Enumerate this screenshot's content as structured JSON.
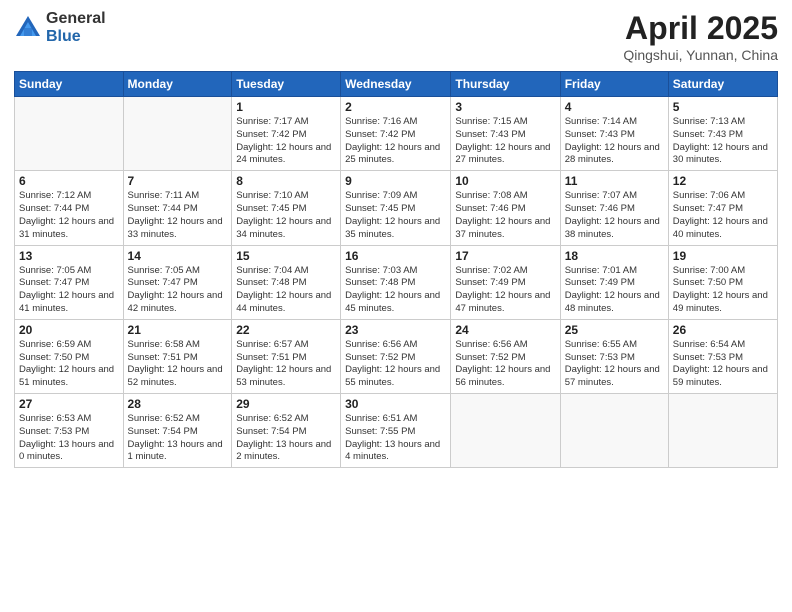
{
  "logo": {
    "general": "General",
    "blue": "Blue"
  },
  "title": "April 2025",
  "location": "Qingshui, Yunnan, China",
  "days_of_week": [
    "Sunday",
    "Monday",
    "Tuesday",
    "Wednesday",
    "Thursday",
    "Friday",
    "Saturday"
  ],
  "weeks": [
    [
      {
        "day": "",
        "info": ""
      },
      {
        "day": "",
        "info": ""
      },
      {
        "day": "1",
        "info": "Sunrise: 7:17 AM\nSunset: 7:42 PM\nDaylight: 12 hours and 24 minutes."
      },
      {
        "day": "2",
        "info": "Sunrise: 7:16 AM\nSunset: 7:42 PM\nDaylight: 12 hours and 25 minutes."
      },
      {
        "day": "3",
        "info": "Sunrise: 7:15 AM\nSunset: 7:43 PM\nDaylight: 12 hours and 27 minutes."
      },
      {
        "day": "4",
        "info": "Sunrise: 7:14 AM\nSunset: 7:43 PM\nDaylight: 12 hours and 28 minutes."
      },
      {
        "day": "5",
        "info": "Sunrise: 7:13 AM\nSunset: 7:43 PM\nDaylight: 12 hours and 30 minutes."
      }
    ],
    [
      {
        "day": "6",
        "info": "Sunrise: 7:12 AM\nSunset: 7:44 PM\nDaylight: 12 hours and 31 minutes."
      },
      {
        "day": "7",
        "info": "Sunrise: 7:11 AM\nSunset: 7:44 PM\nDaylight: 12 hours and 33 minutes."
      },
      {
        "day": "8",
        "info": "Sunrise: 7:10 AM\nSunset: 7:45 PM\nDaylight: 12 hours and 34 minutes."
      },
      {
        "day": "9",
        "info": "Sunrise: 7:09 AM\nSunset: 7:45 PM\nDaylight: 12 hours and 35 minutes."
      },
      {
        "day": "10",
        "info": "Sunrise: 7:08 AM\nSunset: 7:46 PM\nDaylight: 12 hours and 37 minutes."
      },
      {
        "day": "11",
        "info": "Sunrise: 7:07 AM\nSunset: 7:46 PM\nDaylight: 12 hours and 38 minutes."
      },
      {
        "day": "12",
        "info": "Sunrise: 7:06 AM\nSunset: 7:47 PM\nDaylight: 12 hours and 40 minutes."
      }
    ],
    [
      {
        "day": "13",
        "info": "Sunrise: 7:05 AM\nSunset: 7:47 PM\nDaylight: 12 hours and 41 minutes."
      },
      {
        "day": "14",
        "info": "Sunrise: 7:05 AM\nSunset: 7:47 PM\nDaylight: 12 hours and 42 minutes."
      },
      {
        "day": "15",
        "info": "Sunrise: 7:04 AM\nSunset: 7:48 PM\nDaylight: 12 hours and 44 minutes."
      },
      {
        "day": "16",
        "info": "Sunrise: 7:03 AM\nSunset: 7:48 PM\nDaylight: 12 hours and 45 minutes."
      },
      {
        "day": "17",
        "info": "Sunrise: 7:02 AM\nSunset: 7:49 PM\nDaylight: 12 hours and 47 minutes."
      },
      {
        "day": "18",
        "info": "Sunrise: 7:01 AM\nSunset: 7:49 PM\nDaylight: 12 hours and 48 minutes."
      },
      {
        "day": "19",
        "info": "Sunrise: 7:00 AM\nSunset: 7:50 PM\nDaylight: 12 hours and 49 minutes."
      }
    ],
    [
      {
        "day": "20",
        "info": "Sunrise: 6:59 AM\nSunset: 7:50 PM\nDaylight: 12 hours and 51 minutes."
      },
      {
        "day": "21",
        "info": "Sunrise: 6:58 AM\nSunset: 7:51 PM\nDaylight: 12 hours and 52 minutes."
      },
      {
        "day": "22",
        "info": "Sunrise: 6:57 AM\nSunset: 7:51 PM\nDaylight: 12 hours and 53 minutes."
      },
      {
        "day": "23",
        "info": "Sunrise: 6:56 AM\nSunset: 7:52 PM\nDaylight: 12 hours and 55 minutes."
      },
      {
        "day": "24",
        "info": "Sunrise: 6:56 AM\nSunset: 7:52 PM\nDaylight: 12 hours and 56 minutes."
      },
      {
        "day": "25",
        "info": "Sunrise: 6:55 AM\nSunset: 7:53 PM\nDaylight: 12 hours and 57 minutes."
      },
      {
        "day": "26",
        "info": "Sunrise: 6:54 AM\nSunset: 7:53 PM\nDaylight: 12 hours and 59 minutes."
      }
    ],
    [
      {
        "day": "27",
        "info": "Sunrise: 6:53 AM\nSunset: 7:53 PM\nDaylight: 13 hours and 0 minutes."
      },
      {
        "day": "28",
        "info": "Sunrise: 6:52 AM\nSunset: 7:54 PM\nDaylight: 13 hours and 1 minute."
      },
      {
        "day": "29",
        "info": "Sunrise: 6:52 AM\nSunset: 7:54 PM\nDaylight: 13 hours and 2 minutes."
      },
      {
        "day": "30",
        "info": "Sunrise: 6:51 AM\nSunset: 7:55 PM\nDaylight: 13 hours and 4 minutes."
      },
      {
        "day": "",
        "info": ""
      },
      {
        "day": "",
        "info": ""
      },
      {
        "day": "",
        "info": ""
      }
    ]
  ]
}
